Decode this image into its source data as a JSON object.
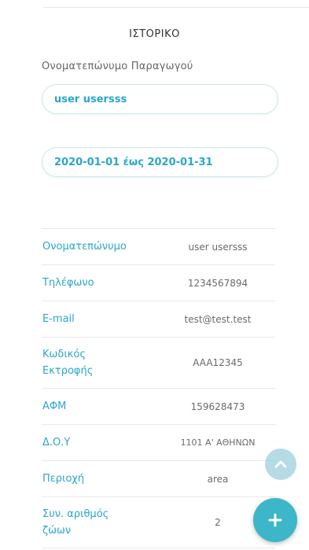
{
  "header": {
    "title": "ΙΣΤΟΡΙΚΟ"
  },
  "producer_field": {
    "label": "Ονοματεπώνυμο Παραγωγού",
    "value": "user usersss"
  },
  "date_range": {
    "value": "2020-01-01 έως 2020-01-31"
  },
  "details": [
    {
      "label": "Ονοματεπώνυμο",
      "value": "user usersss"
    },
    {
      "label": "Τηλέφωνο",
      "value": "1234567894"
    },
    {
      "label": "E-mail",
      "value": "test@test.test"
    },
    {
      "label": "Κωδικός Εκτροφής",
      "value": "AAA12345"
    },
    {
      "label": "ΑΦΜ",
      "value": "159628473"
    },
    {
      "label": "Δ.Ο.Υ",
      "value": "1101 Α' ΑΘΗΝΩΝ"
    },
    {
      "label": "Περιοχή",
      "value": "area"
    },
    {
      "label": "Συν. αριθμός ζώων",
      "value": "2"
    }
  ],
  "buttons": {
    "scroll_top_icon": "chevron-up-icon",
    "add_icon": "plus-icon"
  },
  "colors": {
    "accent": "#2aa6c9",
    "fab": "#3cb6c8"
  }
}
